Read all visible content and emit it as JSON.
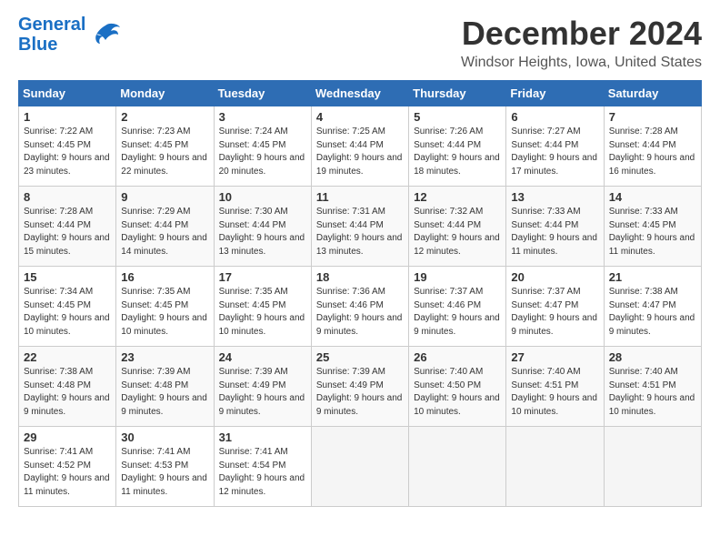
{
  "header": {
    "logo_line1": "General",
    "logo_line2": "Blue",
    "month_title": "December 2024",
    "location": "Windsor Heights, Iowa, United States"
  },
  "weekdays": [
    "Sunday",
    "Monday",
    "Tuesday",
    "Wednesday",
    "Thursday",
    "Friday",
    "Saturday"
  ],
  "weeks": [
    [
      {
        "day": "1",
        "sunrise": "Sunrise: 7:22 AM",
        "sunset": "Sunset: 4:45 PM",
        "daylight": "Daylight: 9 hours and 23 minutes."
      },
      {
        "day": "2",
        "sunrise": "Sunrise: 7:23 AM",
        "sunset": "Sunset: 4:45 PM",
        "daylight": "Daylight: 9 hours and 22 minutes."
      },
      {
        "day": "3",
        "sunrise": "Sunrise: 7:24 AM",
        "sunset": "Sunset: 4:45 PM",
        "daylight": "Daylight: 9 hours and 20 minutes."
      },
      {
        "day": "4",
        "sunrise": "Sunrise: 7:25 AM",
        "sunset": "Sunset: 4:44 PM",
        "daylight": "Daylight: 9 hours and 19 minutes."
      },
      {
        "day": "5",
        "sunrise": "Sunrise: 7:26 AM",
        "sunset": "Sunset: 4:44 PM",
        "daylight": "Daylight: 9 hours and 18 minutes."
      },
      {
        "day": "6",
        "sunrise": "Sunrise: 7:27 AM",
        "sunset": "Sunset: 4:44 PM",
        "daylight": "Daylight: 9 hours and 17 minutes."
      },
      {
        "day": "7",
        "sunrise": "Sunrise: 7:28 AM",
        "sunset": "Sunset: 4:44 PM",
        "daylight": "Daylight: 9 hours and 16 minutes."
      }
    ],
    [
      {
        "day": "8",
        "sunrise": "Sunrise: 7:28 AM",
        "sunset": "Sunset: 4:44 PM",
        "daylight": "Daylight: 9 hours and 15 minutes."
      },
      {
        "day": "9",
        "sunrise": "Sunrise: 7:29 AM",
        "sunset": "Sunset: 4:44 PM",
        "daylight": "Daylight: 9 hours and 14 minutes."
      },
      {
        "day": "10",
        "sunrise": "Sunrise: 7:30 AM",
        "sunset": "Sunset: 4:44 PM",
        "daylight": "Daylight: 9 hours and 13 minutes."
      },
      {
        "day": "11",
        "sunrise": "Sunrise: 7:31 AM",
        "sunset": "Sunset: 4:44 PM",
        "daylight": "Daylight: 9 hours and 13 minutes."
      },
      {
        "day": "12",
        "sunrise": "Sunrise: 7:32 AM",
        "sunset": "Sunset: 4:44 PM",
        "daylight": "Daylight: 9 hours and 12 minutes."
      },
      {
        "day": "13",
        "sunrise": "Sunrise: 7:33 AM",
        "sunset": "Sunset: 4:44 PM",
        "daylight": "Daylight: 9 hours and 11 minutes."
      },
      {
        "day": "14",
        "sunrise": "Sunrise: 7:33 AM",
        "sunset": "Sunset: 4:45 PM",
        "daylight": "Daylight: 9 hours and 11 minutes."
      }
    ],
    [
      {
        "day": "15",
        "sunrise": "Sunrise: 7:34 AM",
        "sunset": "Sunset: 4:45 PM",
        "daylight": "Daylight: 9 hours and 10 minutes."
      },
      {
        "day": "16",
        "sunrise": "Sunrise: 7:35 AM",
        "sunset": "Sunset: 4:45 PM",
        "daylight": "Daylight: 9 hours and 10 minutes."
      },
      {
        "day": "17",
        "sunrise": "Sunrise: 7:35 AM",
        "sunset": "Sunset: 4:45 PM",
        "daylight": "Daylight: 9 hours and 10 minutes."
      },
      {
        "day": "18",
        "sunrise": "Sunrise: 7:36 AM",
        "sunset": "Sunset: 4:46 PM",
        "daylight": "Daylight: 9 hours and 9 minutes."
      },
      {
        "day": "19",
        "sunrise": "Sunrise: 7:37 AM",
        "sunset": "Sunset: 4:46 PM",
        "daylight": "Daylight: 9 hours and 9 minutes."
      },
      {
        "day": "20",
        "sunrise": "Sunrise: 7:37 AM",
        "sunset": "Sunset: 4:47 PM",
        "daylight": "Daylight: 9 hours and 9 minutes."
      },
      {
        "day": "21",
        "sunrise": "Sunrise: 7:38 AM",
        "sunset": "Sunset: 4:47 PM",
        "daylight": "Daylight: 9 hours and 9 minutes."
      }
    ],
    [
      {
        "day": "22",
        "sunrise": "Sunrise: 7:38 AM",
        "sunset": "Sunset: 4:48 PM",
        "daylight": "Daylight: 9 hours and 9 minutes."
      },
      {
        "day": "23",
        "sunrise": "Sunrise: 7:39 AM",
        "sunset": "Sunset: 4:48 PM",
        "daylight": "Daylight: 9 hours and 9 minutes."
      },
      {
        "day": "24",
        "sunrise": "Sunrise: 7:39 AM",
        "sunset": "Sunset: 4:49 PM",
        "daylight": "Daylight: 9 hours and 9 minutes."
      },
      {
        "day": "25",
        "sunrise": "Sunrise: 7:39 AM",
        "sunset": "Sunset: 4:49 PM",
        "daylight": "Daylight: 9 hours and 9 minutes."
      },
      {
        "day": "26",
        "sunrise": "Sunrise: 7:40 AM",
        "sunset": "Sunset: 4:50 PM",
        "daylight": "Daylight: 9 hours and 10 minutes."
      },
      {
        "day": "27",
        "sunrise": "Sunrise: 7:40 AM",
        "sunset": "Sunset: 4:51 PM",
        "daylight": "Daylight: 9 hours and 10 minutes."
      },
      {
        "day": "28",
        "sunrise": "Sunrise: 7:40 AM",
        "sunset": "Sunset: 4:51 PM",
        "daylight": "Daylight: 9 hours and 10 minutes."
      }
    ],
    [
      {
        "day": "29",
        "sunrise": "Sunrise: 7:41 AM",
        "sunset": "Sunset: 4:52 PM",
        "daylight": "Daylight: 9 hours and 11 minutes."
      },
      {
        "day": "30",
        "sunrise": "Sunrise: 7:41 AM",
        "sunset": "Sunset: 4:53 PM",
        "daylight": "Daylight: 9 hours and 11 minutes."
      },
      {
        "day": "31",
        "sunrise": "Sunrise: 7:41 AM",
        "sunset": "Sunset: 4:54 PM",
        "daylight": "Daylight: 9 hours and 12 minutes."
      },
      null,
      null,
      null,
      null
    ]
  ]
}
